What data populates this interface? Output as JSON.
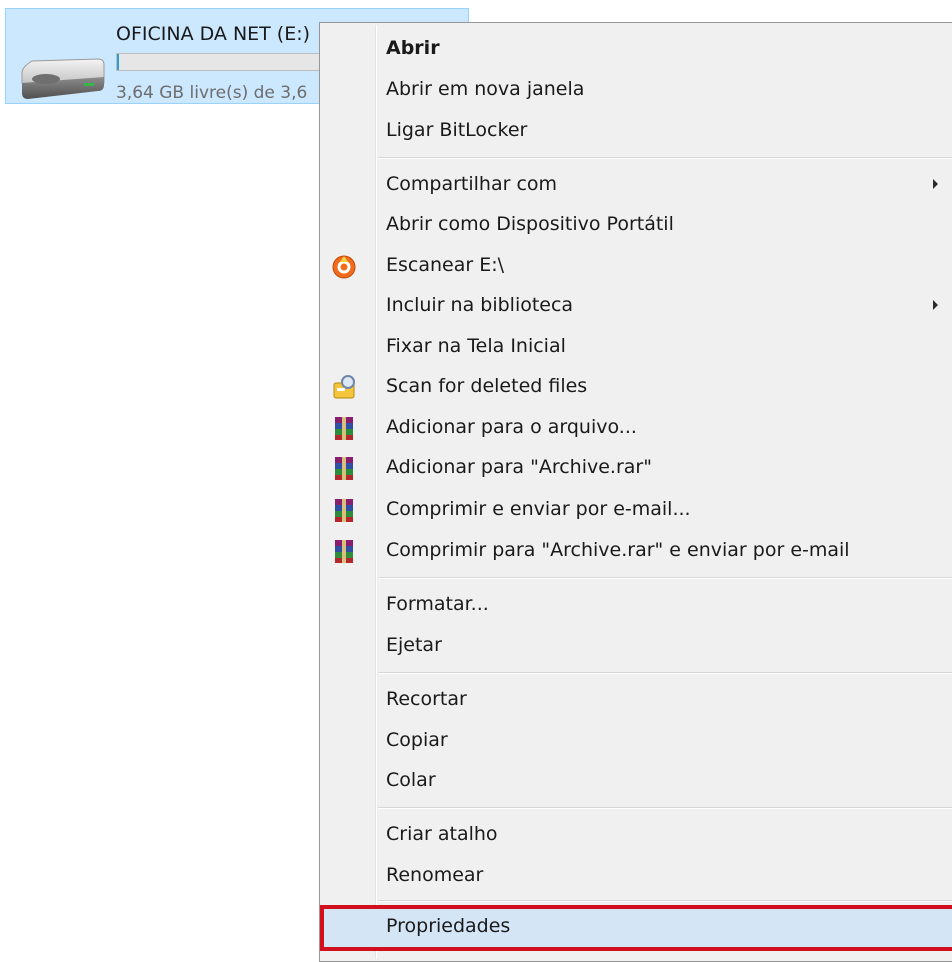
{
  "drive": {
    "name": "OFICINA DA NET (E:)",
    "free_text": "3,64 GB livre(s) de 3,6",
    "usage_fraction": 0.01,
    "bar_color": "#26a0da"
  },
  "menu": {
    "items": [
      {
        "label": "Abrir",
        "bold": true,
        "icon": null,
        "submenu": false
      },
      {
        "label": "Abrir em nova janela",
        "bold": false,
        "icon": null,
        "submenu": false
      },
      {
        "label": "Ligar BitLocker",
        "bold": false,
        "icon": null,
        "submenu": false
      },
      {
        "label": "Compartilhar com",
        "bold": false,
        "icon": null,
        "submenu": true
      },
      {
        "label": "Abrir como Dispositivo Portátil",
        "bold": false,
        "icon": null,
        "submenu": false
      },
      {
        "label": "Escanear E:\\",
        "bold": false,
        "icon": "antivirus-scan-icon",
        "submenu": false
      },
      {
        "label": "Incluir na biblioteca",
        "bold": false,
        "icon": null,
        "submenu": true
      },
      {
        "label": "Fixar na Tela Inicial",
        "bold": false,
        "icon": null,
        "submenu": false
      },
      {
        "label": "Scan for deleted files",
        "bold": false,
        "icon": "recovery-tool-icon",
        "submenu": false
      },
      {
        "label": "Adicionar para o arquivo...",
        "bold": false,
        "icon": "winrar-icon",
        "submenu": false
      },
      {
        "label": "Adicionar para \"Archive.rar\"",
        "bold": false,
        "icon": "winrar-icon",
        "submenu": false
      },
      {
        "label": "Comprimir e enviar por e-mail...",
        "bold": false,
        "icon": "winrar-icon",
        "submenu": false
      },
      {
        "label": "Comprimir para \"Archive.rar\" e enviar por e-mail",
        "bold": false,
        "icon": "winrar-icon",
        "submenu": false
      },
      {
        "label": "Formatar...",
        "bold": false,
        "icon": null,
        "submenu": false
      },
      {
        "label": "Ejetar",
        "bold": false,
        "icon": null,
        "submenu": false
      },
      {
        "label": "Recortar",
        "bold": false,
        "icon": null,
        "submenu": false
      },
      {
        "label": "Copiar",
        "bold": false,
        "icon": null,
        "submenu": false
      },
      {
        "label": "Colar",
        "bold": false,
        "icon": null,
        "submenu": false
      },
      {
        "label": "Criar atalho",
        "bold": false,
        "icon": null,
        "submenu": false
      },
      {
        "label": "Renomear",
        "bold": false,
        "icon": null,
        "submenu": false
      },
      {
        "label": "Propriedades",
        "bold": false,
        "icon": null,
        "submenu": false,
        "highlighted": true
      }
    ],
    "highlight_color": "#d10f1d"
  }
}
